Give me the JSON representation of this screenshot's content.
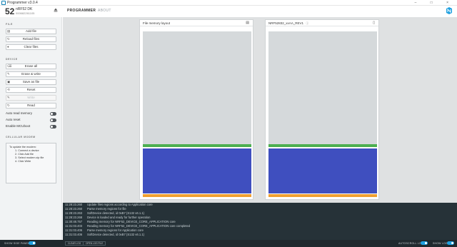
{
  "window": {
    "title": "Programmer v3.0.4",
    "controls": [
      "–",
      "□",
      "×"
    ]
  },
  "device": {
    "short_id": "52",
    "name": "nRF52 DK",
    "serial": "000682261105"
  },
  "nav": {
    "programmer": "PROGRAMMER",
    "about": "ABOUT"
  },
  "sidebar": {
    "file_section": "FILE",
    "add_file": "Add file",
    "reload_files": "Reload files",
    "clear_files": "Clear files",
    "device_section": "DEVICE",
    "erase_all": "Erase all",
    "erase_write": "Erase & write",
    "save_as_file": "Save as file",
    "reset": "Reset",
    "write": "Write",
    "read": "Read",
    "auto_read_memory": "Auto read memory",
    "auto_reset": "Auto reset",
    "enable_mcuboot": "Enable MCUboot",
    "cellular_section": "CELLULAR MODEM",
    "help_intro": "To update the modem:",
    "help_steps": [
      "1. Connect a device",
      "2. Click Add file",
      "3. Select modem zip file",
      "4. Click Write"
    ]
  },
  "cards": {
    "file_memory_title": "File memory layout",
    "device_memory_title": "NRF52832_xxAA_REV1"
  },
  "log": {
    "lines": [
      {
        "time": "11:28:23.260",
        "msg": "Update files regions according to Application core"
      },
      {
        "time": "11:28:23.260",
        "msg": "Parse memory regions for file"
      },
      {
        "time": "11:28:23.263",
        "msg": "SoftDevice detected, id 0xB7 (S132 v6.1.1)"
      },
      {
        "time": "11:28:23.268",
        "msg": "Device is loaded and ready for further operation"
      },
      {
        "time": "11:30:48.757",
        "msg": "Reading memory for NRF52_DEVICE_CORE_APPLICATION core"
      },
      {
        "time": "11:31:03.403",
        "msg": "Reading memory for NRF52_DEVICE_CORE_APPLICATION core completed"
      },
      {
        "time": "11:31:03.406",
        "msg": "Parse memory regions for Application core"
      },
      {
        "time": "11:31:03.406",
        "msg": "SoftDevice detected, id 0xB7 (S132 v6.1.1)"
      }
    ]
  },
  "footer": {
    "show_side_panel": "SHOW SIDE PANEL",
    "clear_log": "CLEAR LOG",
    "open_log_file": "OPEN LOG FILE",
    "autoscroll_log": "AUTOSCROLL LOG",
    "show_log": "SHOW LOG"
  },
  "colors": {
    "accent": "#1ea0e0",
    "memory_empty": "#d5d9db",
    "softdevice_green": "#4caf50",
    "application_blue": "#3f4fbf",
    "bootloader_orange": "#f0a030",
    "log_background": "#263238"
  },
  "icons": {
    "eject": "eject-icon",
    "logo": "nordic-logo-icon",
    "add_file": "folder-open-icon",
    "reload": "refresh-icon",
    "clear": "clear-icon",
    "erase_all": "eraser-icon",
    "erase_write": "pencil-icon",
    "save": "save-icon",
    "reset": "reset-icon",
    "write": "pencil-icon",
    "read": "refresh-icon"
  }
}
